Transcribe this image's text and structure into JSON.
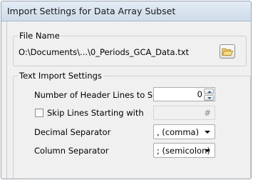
{
  "window": {
    "title": "Import Settings for Data Array Subset"
  },
  "file_group": {
    "legend": "File Name",
    "path": "O:\\Documents\\...\\0_Periods_GCA_Data.txt",
    "browse_icon": "folder-open-icon"
  },
  "text_import_group": {
    "legend": "Text Import Settings",
    "header_lines_label": "Number of Header Lines to Skip",
    "header_lines_value": "0",
    "skip_lines_label": "Skip Lines Starting with",
    "skip_lines_checked": false,
    "skip_lines_value": "#",
    "decimal_separator_label": "Decimal Separator",
    "decimal_separator_value": ", (comma)",
    "column_separator_label": "Column Separator",
    "column_separator_value": "; (semicolon)"
  },
  "colors": {
    "titlebar": "#d7e3f0",
    "dialog_bg": "#f0f0f0",
    "folder_icon": "#e8b84a"
  }
}
